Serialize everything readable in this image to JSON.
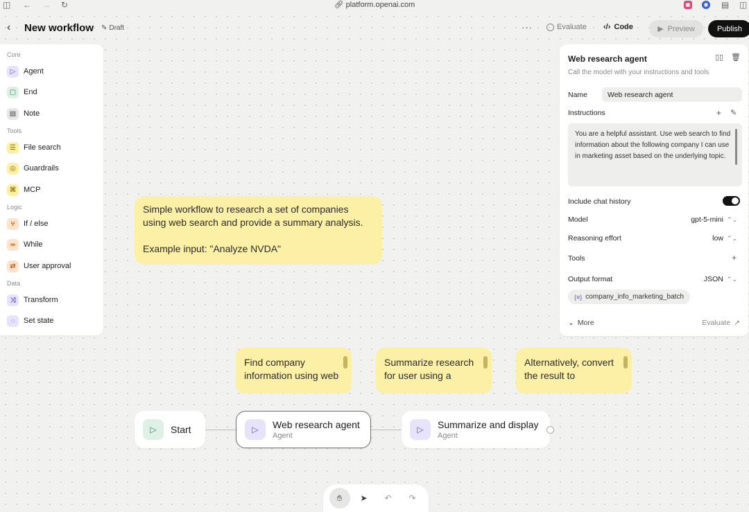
{
  "browser": {
    "url": "platform.openai.com"
  },
  "header": {
    "title": "New workflow",
    "draft_label": "Draft",
    "evaluate_label": "Evaluate",
    "code_label": "Code",
    "preview_label": "Preview",
    "publish_label": "Publish"
  },
  "palette": {
    "sections": [
      {
        "label": "Core",
        "items": [
          {
            "label": "Agent",
            "icon": "agent-icon",
            "color": "#e6e3fb"
          },
          {
            "label": "End",
            "icon": "end-icon",
            "color": "#dff1e7"
          },
          {
            "label": "Note",
            "icon": "note-icon",
            "color": "#e6e6e4"
          }
        ]
      },
      {
        "label": "Tools",
        "items": [
          {
            "label": "File search",
            "icon": "database-icon",
            "color": "#fcefa6"
          },
          {
            "label": "Guardrails",
            "icon": "shield-icon",
            "color": "#fcefa6"
          },
          {
            "label": "MCP",
            "icon": "command-icon",
            "color": "#fcefa6"
          }
        ]
      },
      {
        "label": "Logic",
        "items": [
          {
            "label": "If / else",
            "icon": "branch-icon",
            "color": "#fde3cc"
          },
          {
            "label": "While",
            "icon": "loop-icon",
            "color": "#fde3cc"
          },
          {
            "label": "User approval",
            "icon": "approval-icon",
            "color": "#fde3cc"
          }
        ]
      },
      {
        "label": "Data",
        "items": [
          {
            "label": "Transform",
            "icon": "shuffle-icon",
            "color": "#e6e3fb"
          },
          {
            "label": "Set state",
            "icon": "state-icon",
            "color": "#e6e3fb"
          }
        ]
      }
    ]
  },
  "canvas": {
    "intro_note": {
      "line1": "Simple workflow to research a set of companies using web search and provide a summary analysis.",
      "line2": "Example input: \"Analyze NVDA\""
    },
    "notes": [
      {
        "text": "Find company information using web"
      },
      {
        "text": "Summarize research for user using a"
      },
      {
        "text": "Alternatively, convert the result to"
      }
    ],
    "nodes": {
      "start": {
        "title": "Start"
      },
      "research": {
        "title": "Web research agent",
        "subtitle": "Agent"
      },
      "summarize": {
        "title": "Summarize and display",
        "subtitle": "Agent"
      }
    }
  },
  "inspector": {
    "title": "Web research agent",
    "subtitle": "Call the model with your instructions and tools",
    "name_label": "Name",
    "name_value": "Web research agent",
    "instructions_label": "Instructions",
    "instructions_text": "You are a helpful assistant. Use web search to find information about the following company I can use in marketing asset based on the underlying topic.",
    "chat_history_label": "Include chat history",
    "chat_history_on": true,
    "model_label": "Model",
    "model_value": "gpt-5-mini",
    "reasoning_label": "Reasoning effort",
    "reasoning_value": "low",
    "tools_label": "Tools",
    "output_format_label": "Output format",
    "output_format_value": "JSON",
    "schema_chip": "company_info_marketing_batch",
    "more_label": "More",
    "evaluate_label": "Evaluate"
  },
  "colors": {
    "note_yellow": "#fcefa6",
    "publish_bg": "#111111",
    "canvas_bg": "#f1f1f0"
  }
}
